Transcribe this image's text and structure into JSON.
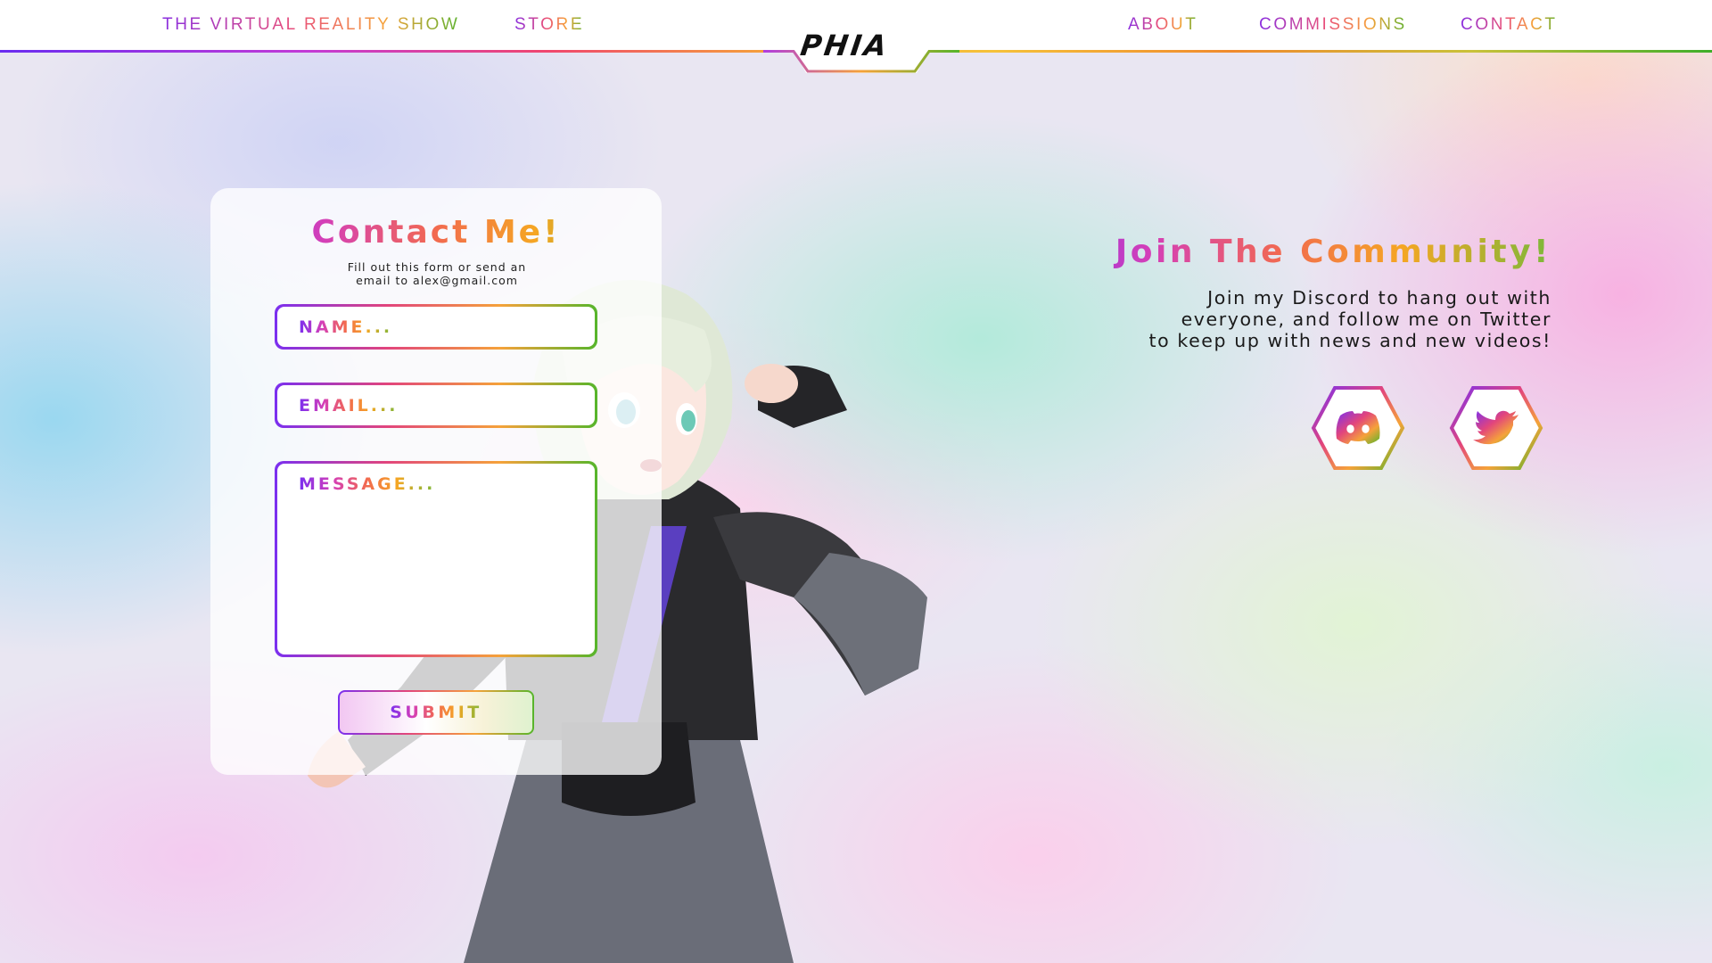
{
  "nav": {
    "links_left": [
      "THE VIRTUAL REALITY SHOW",
      "STORE"
    ],
    "logo": "PHIA",
    "links_right": [
      "ABOUT",
      "COMMISSIONS",
      "CONTACT"
    ]
  },
  "contact": {
    "title": "Contact Me!",
    "subtitle_line1": "Fill out this form or send an",
    "subtitle_line2": "email to alex@gmail.com",
    "name_placeholder": "NAME...",
    "email_placeholder": "EMAIL...",
    "message_placeholder": "MESSAGE...",
    "submit_label": "SUBMIT"
  },
  "community": {
    "title": "Join The Community!",
    "text_line1": "Join my Discord to hang out with",
    "text_line2": "everyone, and follow me on Twitter",
    "text_line3": "to keep up with news and new videos!",
    "social_icons": [
      "discord-icon",
      "twitter-icon"
    ]
  },
  "colors": {
    "gradient": [
      "#7a2ff0",
      "#e2457c",
      "#f5a23a",
      "#56b52b"
    ],
    "card_bg": "#ffffff",
    "text_dark": "#1a1a1a"
  }
}
